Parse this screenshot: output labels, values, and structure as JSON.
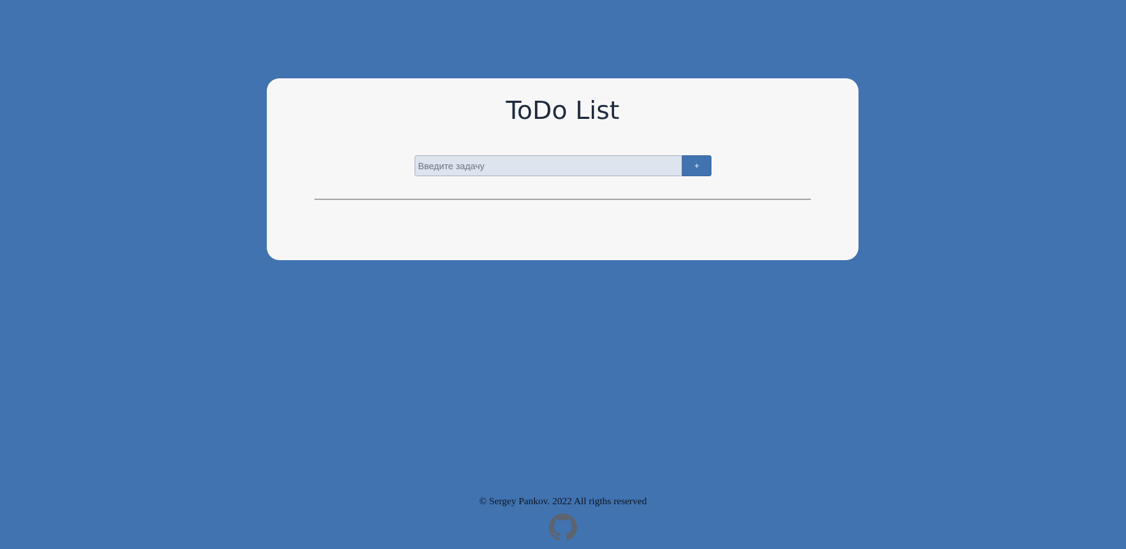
{
  "app": {
    "title": "ToDo List"
  },
  "form": {
    "input_placeholder": "Введите задачу",
    "input_value": "",
    "add_label": "+"
  },
  "tasks": [],
  "footer": {
    "copyright": "© Sergey Pankov. 2022 All rigths reserved",
    "github_icon": "github-icon"
  },
  "colors": {
    "background": "#4173b0",
    "card": "#f8f7f8",
    "accent": "#4173b0",
    "input_bg": "#dde4ee",
    "title": "#1d2b3e"
  }
}
